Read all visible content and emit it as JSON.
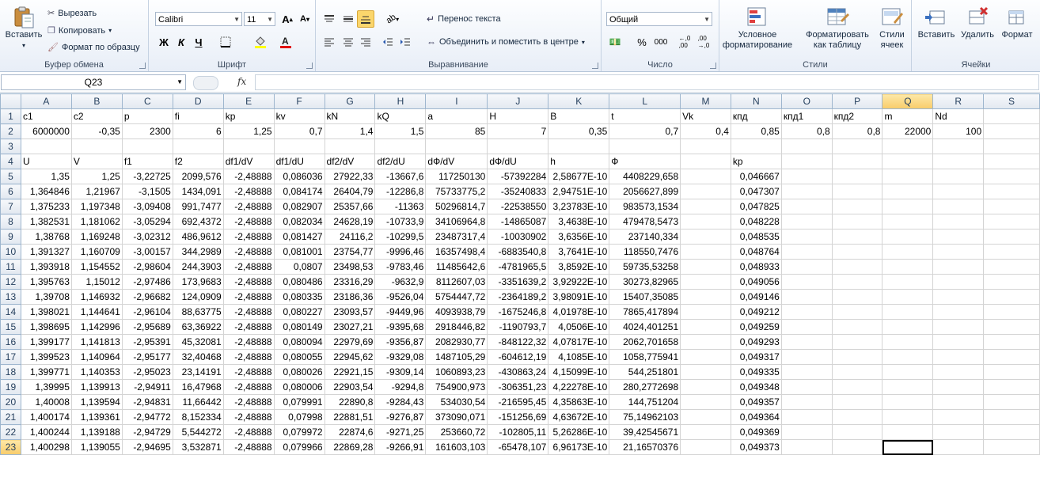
{
  "ribbon": {
    "clipboard": {
      "label": "Буфер обмена",
      "paste": "Вставить",
      "cut": "Вырезать",
      "copy": "Копировать",
      "format_painter": "Формат по образцу"
    },
    "font": {
      "label": "Шрифт",
      "font_name": "Calibri",
      "font_size": "11",
      "bold": "Ж",
      "italic": "К",
      "underline": "Ч"
    },
    "alignment": {
      "label": "Выравнивание",
      "wrap_text": "Перенос текста",
      "merge_center": "Объединить и поместить в центре"
    },
    "number": {
      "label": "Число",
      "format": "Общий",
      "percent": "%",
      "thousands": "000"
    },
    "styles": {
      "label": "Стили",
      "conditional": "Условное форматирование",
      "as_table": "Форматировать как таблицу",
      "cell_styles": "Стили ячеек"
    },
    "cells": {
      "label": "Ячейки",
      "insert": "Вставить",
      "delete": "Удалить",
      "format": "Формат"
    }
  },
  "formula_bar": {
    "name_box": "Q23",
    "fx": "fx",
    "formula": ""
  },
  "colors": {
    "accent": "#fbd66c",
    "header_bg": "#e4ecf7",
    "selection": "#000000"
  },
  "grid": {
    "columns": [
      "A",
      "B",
      "C",
      "D",
      "E",
      "F",
      "G",
      "H",
      "I",
      "J",
      "K",
      "L",
      "M",
      "N",
      "O",
      "P",
      "Q",
      "R",
      "S"
    ],
    "active_column": "Q",
    "active_row": 23,
    "rows": [
      {
        "n": "1",
        "cells": [
          "c1",
          "c2",
          "p",
          "fi",
          "kp",
          "kv",
          "kN",
          "kQ",
          "a",
          "H",
          "B",
          "t",
          "Vk",
          "кпд",
          "кпд1",
          "кпд2",
          "m",
          "Nd",
          ""
        ]
      },
      {
        "n": "2",
        "cells": [
          "6000000",
          "-0,35",
          "2300",
          "6",
          "1,25",
          "0,7",
          "1,4",
          "1,5",
          "85",
          "7",
          "0,35",
          "0,7",
          "0,4",
          "0,85",
          "0,8",
          "0,8",
          "22000",
          "100",
          ""
        ]
      },
      {
        "n": "3",
        "cells": [
          "",
          "",
          "",
          "",
          "",
          "",
          "",
          "",
          "",
          "",
          "",
          "",
          "",
          "",
          "",
          "",
          "",
          "",
          ""
        ]
      },
      {
        "n": "4",
        "cells": [
          "U",
          "V",
          "f1",
          "f2",
          "df1/dV",
          "df1/dU",
          "df2/dV",
          "df2/dU",
          "dФ/dV",
          "dФ/dU",
          "h",
          "Ф",
          "",
          "kp",
          "",
          "",
          "",
          "",
          ""
        ]
      },
      {
        "n": "5",
        "cells": [
          "1,35",
          "1,25",
          "-3,22725",
          "2099,576",
          "-2,48888",
          "0,086036",
          "27922,33",
          "-13667,6",
          "117250130",
          "-57392284",
          "2,58677E-10",
          "4408229,658",
          "",
          "0,046667",
          "",
          "",
          "",
          "",
          ""
        ]
      },
      {
        "n": "6",
        "cells": [
          "1,364846",
          "1,21967",
          "-3,1505",
          "1434,091",
          "-2,48888",
          "0,084174",
          "26404,79",
          "-12286,8",
          "75733775,2",
          "-35240833",
          "2,94751E-10",
          "2056627,899",
          "",
          "0,047307",
          "",
          "",
          "",
          "",
          ""
        ]
      },
      {
        "n": "7",
        "cells": [
          "1,375233",
          "1,197348",
          "-3,09408",
          "991,7477",
          "-2,48888",
          "0,082907",
          "25357,66",
          "-11363",
          "50296814,7",
          "-22538550",
          "3,23783E-10",
          "983573,1534",
          "",
          "0,047825",
          "",
          "",
          "",
          "",
          ""
        ]
      },
      {
        "n": "8",
        "cells": [
          "1,382531",
          "1,181062",
          "-3,05294",
          "692,4372",
          "-2,48888",
          "0,082034",
          "24628,19",
          "-10733,9",
          "34106964,8",
          "-14865087",
          "3,4638E-10",
          "479478,5473",
          "",
          "0,048228",
          "",
          "",
          "",
          "",
          ""
        ]
      },
      {
        "n": "9",
        "cells": [
          "1,38768",
          "1,169248",
          "-3,02312",
          "486,9612",
          "-2,48888",
          "0,081427",
          "24116,2",
          "-10299,5",
          "23487317,4",
          "-10030902",
          "3,6356E-10",
          "237140,334",
          "",
          "0,048535",
          "",
          "",
          "",
          "",
          ""
        ]
      },
      {
        "n": "10",
        "cells": [
          "1,391327",
          "1,160709",
          "-3,00157",
          "344,2989",
          "-2,48888",
          "0,081001",
          "23754,77",
          "-9996,46",
          "16357498,4",
          "-6883540,8",
          "3,7641E-10",
          "118550,7476",
          "",
          "0,048764",
          "",
          "",
          "",
          "",
          ""
        ]
      },
      {
        "n": "11",
        "cells": [
          "1,393918",
          "1,154552",
          "-2,98604",
          "244,3903",
          "-2,48888",
          "0,0807",
          "23498,53",
          "-9783,46",
          "11485642,6",
          "-4781965,5",
          "3,8592E-10",
          "59735,53258",
          "",
          "0,048933",
          "",
          "",
          "",
          "",
          ""
        ]
      },
      {
        "n": "12",
        "cells": [
          "1,395763",
          "1,15012",
          "-2,97486",
          "173,9683",
          "-2,48888",
          "0,080486",
          "23316,29",
          "-9632,9",
          "8112607,03",
          "-3351639,2",
          "3,92922E-10",
          "30273,82965",
          "",
          "0,049056",
          "",
          "",
          "",
          "",
          ""
        ]
      },
      {
        "n": "13",
        "cells": [
          "1,39708",
          "1,146932",
          "-2,96682",
          "124,0909",
          "-2,48888",
          "0,080335",
          "23186,36",
          "-9526,04",
          "5754447,72",
          "-2364189,2",
          "3,98091E-10",
          "15407,35085",
          "",
          "0,049146",
          "",
          "",
          "",
          "",
          ""
        ]
      },
      {
        "n": "14",
        "cells": [
          "1,398021",
          "1,144641",
          "-2,96104",
          "88,63775",
          "-2,48888",
          "0,080227",
          "23093,57",
          "-9449,96",
          "4093938,79",
          "-1675246,8",
          "4,01978E-10",
          "7865,417894",
          "",
          "0,049212",
          "",
          "",
          "",
          "",
          ""
        ]
      },
      {
        "n": "15",
        "cells": [
          "1,398695",
          "1,142996",
          "-2,95689",
          "63,36922",
          "-2,48888",
          "0,080149",
          "23027,21",
          "-9395,68",
          "2918446,82",
          "-1190793,7",
          "4,0506E-10",
          "4024,401251",
          "",
          "0,049259",
          "",
          "",
          "",
          "",
          ""
        ]
      },
      {
        "n": "16",
        "cells": [
          "1,399177",
          "1,141813",
          "-2,95391",
          "45,32081",
          "-2,48888",
          "0,080094",
          "22979,69",
          "-9356,87",
          "2082930,77",
          "-848122,32",
          "4,07817E-10",
          "2062,701658",
          "",
          "0,049293",
          "",
          "",
          "",
          "",
          ""
        ]
      },
      {
        "n": "17",
        "cells": [
          "1,399523",
          "1,140964",
          "-2,95177",
          "32,40468",
          "-2,48888",
          "0,080055",
          "22945,62",
          "-9329,08",
          "1487105,29",
          "-604612,19",
          "4,1085E-10",
          "1058,775941",
          "",
          "0,049317",
          "",
          "",
          "",
          "",
          ""
        ]
      },
      {
        "n": "18",
        "cells": [
          "1,399771",
          "1,140353",
          "-2,95023",
          "23,14191",
          "-2,48888",
          "0,080026",
          "22921,15",
          "-9309,14",
          "1060893,23",
          "-430863,24",
          "4,15099E-10",
          "544,251801",
          "",
          "0,049335",
          "",
          "",
          "",
          "",
          ""
        ]
      },
      {
        "n": "19",
        "cells": [
          "1,39995",
          "1,139913",
          "-2,94911",
          "16,47968",
          "-2,48888",
          "0,080006",
          "22903,54",
          "-9294,8",
          "754900,973",
          "-306351,23",
          "4,22278E-10",
          "280,2772698",
          "",
          "0,049348",
          "",
          "",
          "",
          "",
          ""
        ]
      },
      {
        "n": "20",
        "cells": [
          "1,40008",
          "1,139594",
          "-2,94831",
          "11,66442",
          "-2,48888",
          "0,079991",
          "22890,8",
          "-9284,43",
          "534030,54",
          "-216595,45",
          "4,35863E-10",
          "144,751204",
          "",
          "0,049357",
          "",
          "",
          "",
          "",
          ""
        ]
      },
      {
        "n": "21",
        "cells": [
          "1,400174",
          "1,139361",
          "-2,94772",
          "8,152334",
          "-2,48888",
          "0,07998",
          "22881,51",
          "-9276,87",
          "373090,071",
          "-151256,69",
          "4,63672E-10",
          "75,14962103",
          "",
          "0,049364",
          "",
          "",
          "",
          "",
          ""
        ]
      },
      {
        "n": "22",
        "cells": [
          "1,400244",
          "1,139188",
          "-2,94729",
          "5,544272",
          "-2,48888",
          "0,079972",
          "22874,6",
          "-9271,25",
          "253660,72",
          "-102805,11",
          "5,26286E-10",
          "39,42545671",
          "",
          "0,049369",
          "",
          "",
          "",
          "",
          ""
        ]
      },
      {
        "n": "23",
        "cells": [
          "1,400298",
          "1,139055",
          "-2,94695",
          "3,532871",
          "-2,48888",
          "0,079966",
          "22869,28",
          "-9266,91",
          "161603,103",
          "-65478,107",
          "6,96173E-10",
          "21,16570376",
          "",
          "0,049373",
          "",
          "",
          "",
          "",
          ""
        ]
      }
    ]
  }
}
